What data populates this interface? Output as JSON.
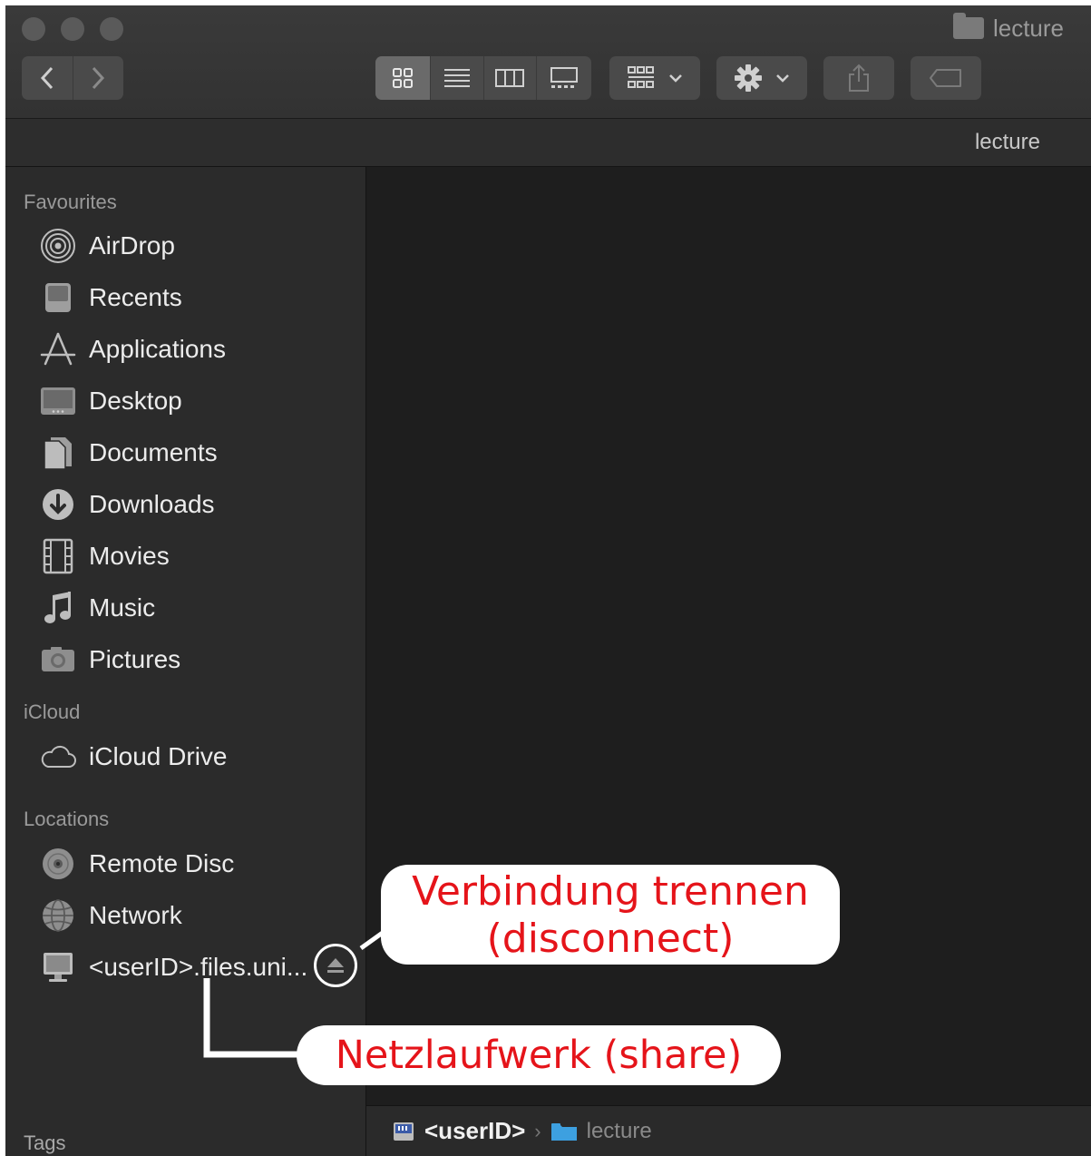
{
  "window": {
    "title": "lecture"
  },
  "path_header": {
    "label": "lecture"
  },
  "sidebar": {
    "favourites_title": "Favourites",
    "favourites": [
      {
        "label": "AirDrop",
        "icon": "airdrop-icon"
      },
      {
        "label": "Recents",
        "icon": "recents-icon"
      },
      {
        "label": "Applications",
        "icon": "applications-icon"
      },
      {
        "label": "Desktop",
        "icon": "desktop-icon"
      },
      {
        "label": "Documents",
        "icon": "documents-icon"
      },
      {
        "label": "Downloads",
        "icon": "downloads-icon"
      },
      {
        "label": "Movies",
        "icon": "movies-icon"
      },
      {
        "label": "Music",
        "icon": "music-icon"
      },
      {
        "label": "Pictures",
        "icon": "pictures-icon"
      }
    ],
    "icloud_title": "iCloud",
    "icloud": [
      {
        "label": "iCloud Drive",
        "icon": "icloud-icon"
      }
    ],
    "locations_title": "Locations",
    "locations": [
      {
        "label": "Remote Disc",
        "icon": "remote-disc-icon"
      },
      {
        "label": "Network",
        "icon": "network-icon"
      },
      {
        "label": "<userID>.files.uni...",
        "icon": "server-icon"
      }
    ],
    "tags_title": "Tags"
  },
  "pathbar": {
    "segments": [
      "<userID>",
      "lecture"
    ]
  },
  "annotations": {
    "disconnect": [
      "Verbindung trennen",
      "(disconnect)"
    ],
    "share": "Netzlaufwerk (share)",
    "color": "#e5141a"
  }
}
